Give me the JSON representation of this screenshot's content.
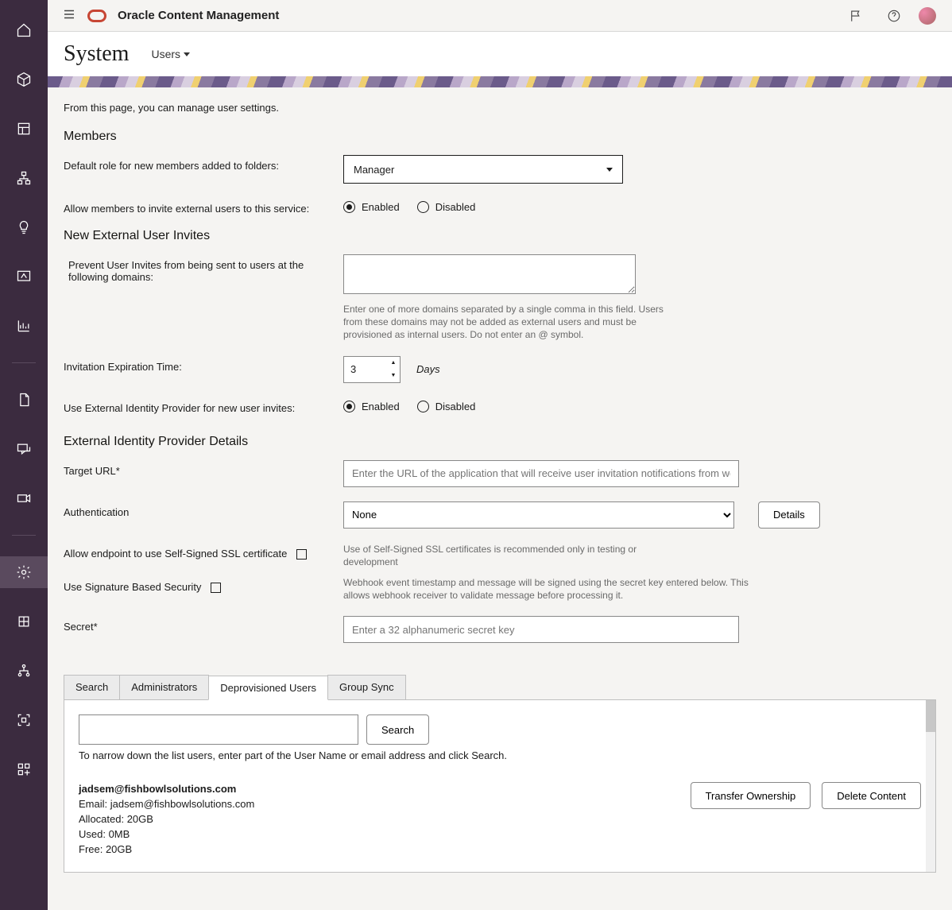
{
  "header": {
    "app_title": "Oracle Content Management"
  },
  "subheader": {
    "title": "System",
    "menu_label": "Users"
  },
  "intro": "From this page, you can manage user settings.",
  "members": {
    "heading": "Members",
    "default_role_label": "Default role for new members added to folders:",
    "default_role_value": "Manager",
    "allow_external_label": "Allow members to invite external users to this service:",
    "enabled": "Enabled",
    "disabled": "Disabled"
  },
  "invites": {
    "heading": "New External User Invites",
    "prevent_label": "Prevent User Invites from being sent to users at the following domains:",
    "domains_value": "",
    "domains_hint": "Enter one of more domains separated by a single comma in this field. Users from these domains may not be added as external users and must be provisioned as internal users. Do not enter an @ symbol.",
    "expiration_label": "Invitation Expiration Time:",
    "expiration_value": "3",
    "expiration_unit": "Days",
    "use_idp_label": "Use External Identity Provider for new user invites:"
  },
  "idp": {
    "heading": "External Identity Provider Details",
    "target_url_label": "Target URL*",
    "target_url_placeholder": "Enter the URL of the application that will receive user invitation notifications from webhooks",
    "auth_label": "Authentication",
    "auth_value": "None",
    "details_btn": "Details",
    "self_signed_label": "Allow endpoint to use Self-Signed SSL certificate",
    "self_signed_hint": "Use of Self-Signed SSL certificates is recommended only in testing or development",
    "signature_label": "Use Signature Based Security",
    "signature_hint": "Webhook event timestamp and message will be signed using the secret key entered below. This allows webhook receiver to validate message before processing it.",
    "secret_label": "Secret*",
    "secret_placeholder": "Enter a 32 alphanumeric secret key"
  },
  "tabs": {
    "items": [
      "Search",
      "Administrators",
      "Deprovisioned Users",
      "Group Sync"
    ],
    "active": 2,
    "search_btn": "Search",
    "search_hint": "To narrow down the list users, enter part of the User Name or email address and click Search.",
    "user": {
      "name": "jadsem@fishbowlsolutions.com",
      "email_line": "Email: jadsem@fishbowlsolutions.com",
      "allocated": "Allocated: 20GB",
      "used": "Used: 0MB",
      "free": "Free: 20GB"
    },
    "transfer_btn": "Transfer Ownership",
    "delete_btn": "Delete Content"
  }
}
